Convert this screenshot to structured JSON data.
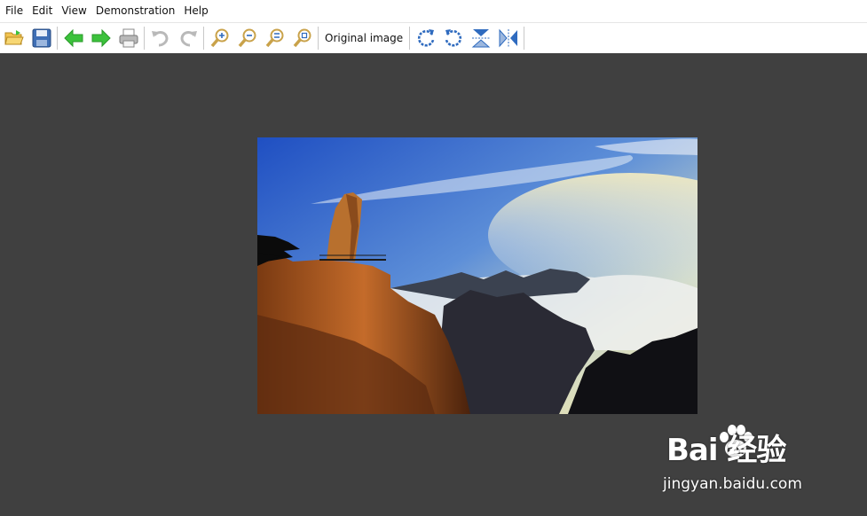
{
  "menu": [
    "File",
    "Edit",
    "View",
    "Demonstration",
    "Help"
  ],
  "toolbar": {
    "original_image_label": "Original image",
    "icons": [
      "open-folder-icon",
      "save-icon",
      "back-arrow-icon",
      "forward-arrow-icon",
      "print-icon",
      "undo-icon",
      "redo-icon",
      "zoom-in-icon",
      "zoom-out-icon",
      "zoom-fit-icon",
      "zoom-actual-icon",
      "rotate-right-icon",
      "rotate-left-icon",
      "flip-vertical-icon",
      "flip-horizontal-icon"
    ]
  },
  "colors": {
    "canvas_bg": "#404040",
    "accent_green": "#3cc23c",
    "accent_blue": "#2f6bbf"
  },
  "watermark": {
    "brand_text": "Bai 经验",
    "url_text": "jingyan.baidu.com"
  }
}
